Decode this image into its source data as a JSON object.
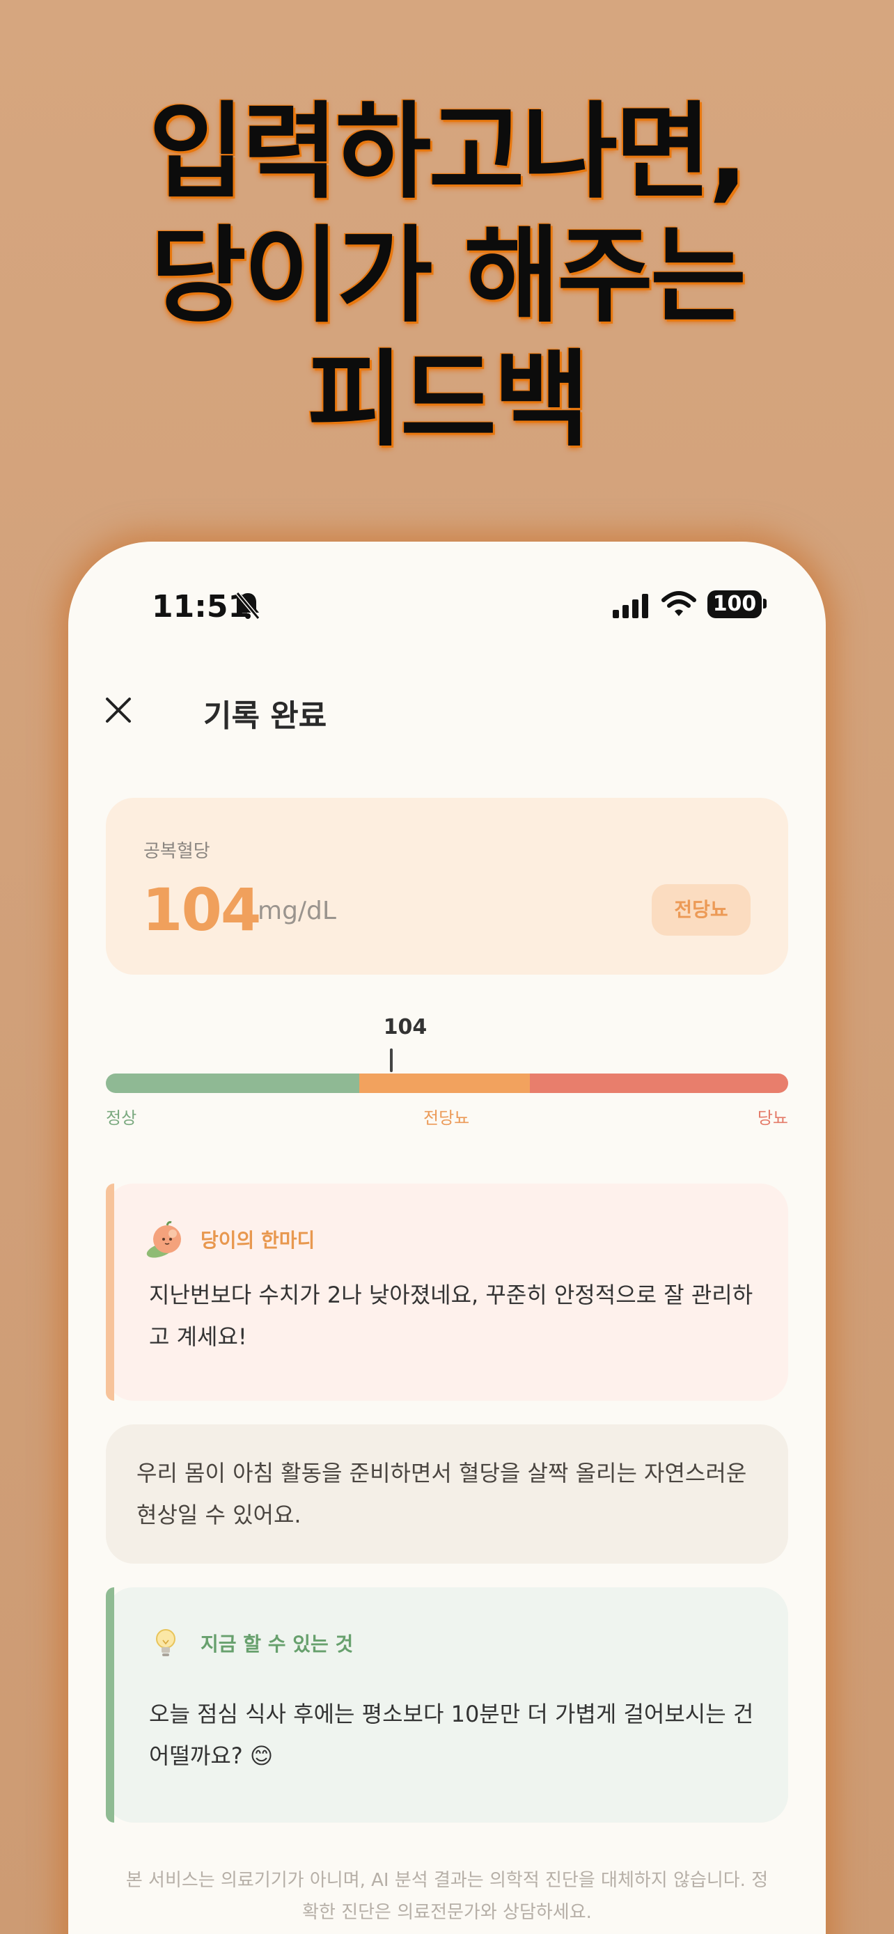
{
  "headline": {
    "line1": "입력하고나면,",
    "line2": "당이가 해주는",
    "line3": "피드백"
  },
  "status_bar": {
    "time": "11:51",
    "battery": "100",
    "icons": [
      "bell-slash-icon",
      "cellular-signal-icon",
      "wifi-icon",
      "battery-icon"
    ]
  },
  "header": {
    "title": "기록 완료",
    "close_icon": "close-icon"
  },
  "reading": {
    "label": "공복혈당",
    "value": "104",
    "unit": "mg/dL",
    "status_badge": "전당뇨"
  },
  "gauge": {
    "marker_value": "104",
    "ranges": [
      {
        "label": "정상",
        "color": "#8fb994"
      },
      {
        "label": "전당뇨",
        "color": "#f2a25e"
      },
      {
        "label": "당뇨",
        "color": "#e87e6c"
      }
    ]
  },
  "comment_card": {
    "icon": "peach-mascot-icon",
    "title": "당이의 한마디",
    "line1": "지난번보다 수치가 2나 낮아졌네요, 꾸준히 안정적으로 잘 관리하",
    "line2": "고 계세요!"
  },
  "info_card": {
    "line1": "우리 몸이 아침 활동을 준비하면서 혈당을 살짝 올리는 자연스러운",
    "line2": "현상일 수 있어요."
  },
  "tip_card": {
    "icon": "lightbulb-icon",
    "title": "지금 할 수 있는 것",
    "line1": "오늘 점심 식사 후에는 평소보다 10분만 더 가볍게 걸어보시는 건",
    "line2": "어떨까요? 😊"
  },
  "disclaimer": {
    "line1": "본 서비스는 의료기기가 아니며, AI 분석 결과는 의학적 진단을 대체하지 않습니다. 정",
    "line2": "확한 진단은 의료전문가와 상담하세요."
  },
  "colors": {
    "background": "#d2a27c",
    "accent_orange": "#f0a05c",
    "normal_green": "#8fb994",
    "danger_red": "#e87e6c"
  }
}
